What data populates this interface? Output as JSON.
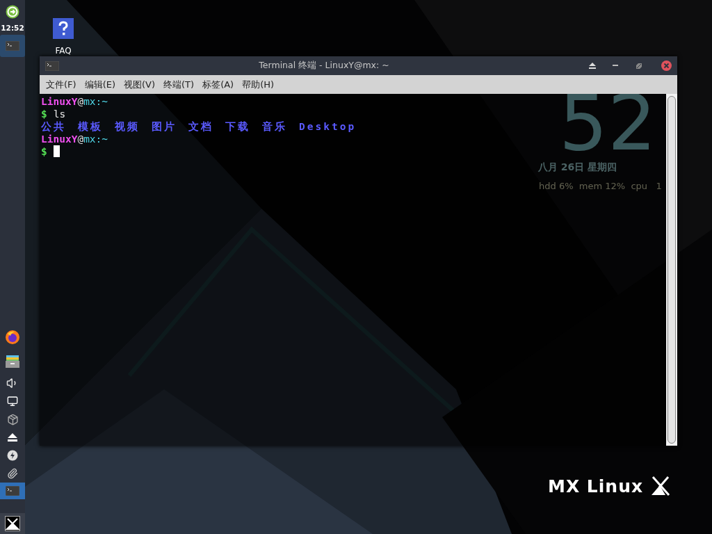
{
  "panel": {
    "clock": "12:52",
    "top_items": [
      {
        "kind": "updater",
        "selected": false
      },
      {
        "kind": "terminal",
        "selected": true
      }
    ],
    "tray": [
      {
        "kind": "firefox",
        "selected": false
      },
      {
        "kind": "files",
        "selected": false
      },
      {
        "kind": "volume",
        "selected": false
      },
      {
        "kind": "display",
        "selected": false
      },
      {
        "kind": "package",
        "selected": false
      },
      {
        "kind": "eject",
        "selected": false
      },
      {
        "kind": "power",
        "selected": false
      },
      {
        "kind": "clip",
        "selected": false
      },
      {
        "kind": "terminal",
        "selected": true
      }
    ],
    "menu_button": {
      "kind": "mx"
    }
  },
  "desktop": {
    "icons": [
      {
        "label": "FAQ"
      }
    ],
    "clock_widget": {
      "minute": "52",
      "date": "八月 26日 星期四",
      "stats": "hdd 6%  mem 12%  cpu   1"
    },
    "logo": {
      "text": "MX Linux"
    }
  },
  "window": {
    "title": "Terminal 终端 - LinuxY@mx: ~",
    "menu": [
      "文件(F)",
      "编辑(E)",
      "视图(V)",
      "终端(T)",
      "标签(A)",
      "帮助(H)"
    ],
    "lines": [
      {
        "segments": [
          {
            "kind": "user",
            "text": "LinuxY"
          },
          {
            "kind": "at",
            "text": "@"
          },
          {
            "kind": "host",
            "text": "mx"
          },
          {
            "kind": "path",
            "text": ":~"
          }
        ]
      },
      {
        "segments": [
          {
            "kind": "dollar",
            "text": "$"
          },
          {
            "kind": "command",
            "text": "ls"
          }
        ]
      },
      {
        "segments": [
          {
            "kind": "dir",
            "text": "公共"
          },
          {
            "kind": "dir",
            "text": "模板"
          },
          {
            "kind": "dir",
            "text": "视频"
          },
          {
            "kind": "dir",
            "text": "图片"
          },
          {
            "kind": "dir",
            "text": "文档"
          },
          {
            "kind": "dir",
            "text": "下载"
          },
          {
            "kind": "dir",
            "text": "音乐"
          },
          {
            "kind": "dir",
            "text": "Desktop"
          }
        ]
      },
      {
        "segments": [
          {
            "kind": "user",
            "text": "LinuxY"
          },
          {
            "kind": "at",
            "text": "@"
          },
          {
            "kind": "host",
            "text": "mx"
          },
          {
            "kind": "path",
            "text": ":~"
          }
        ]
      },
      {
        "segments": [
          {
            "kind": "dollar",
            "text": "$"
          },
          {
            "kind": "cursor"
          }
        ]
      }
    ]
  }
}
